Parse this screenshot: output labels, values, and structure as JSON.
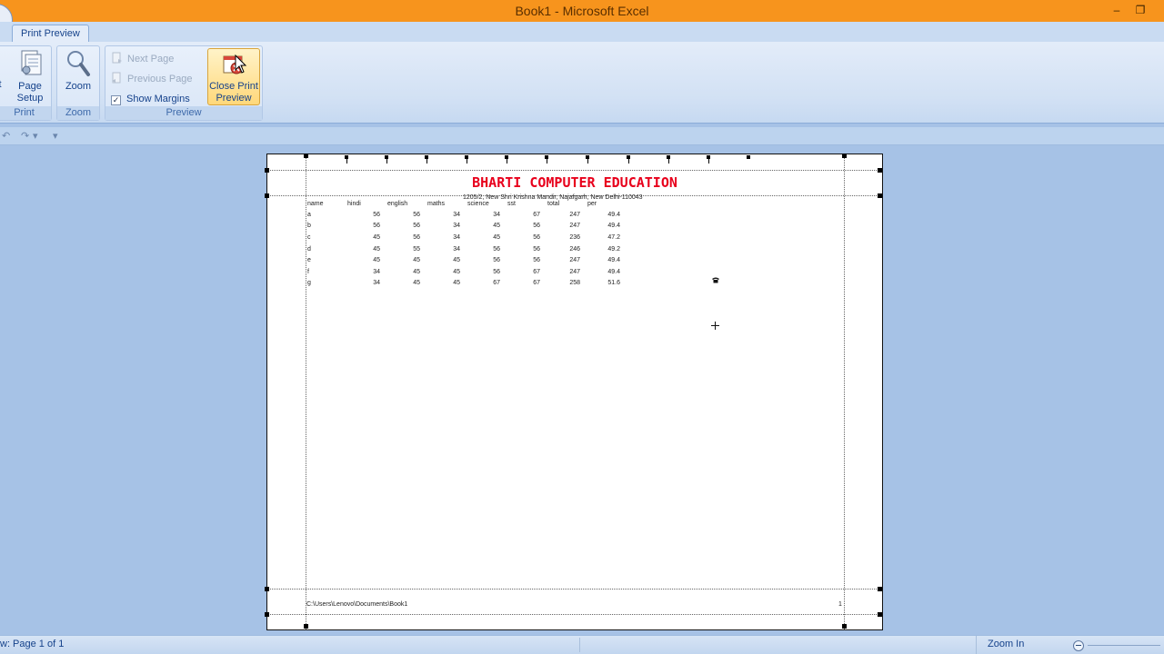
{
  "window": {
    "title": "Book1 - Microsoft Excel",
    "minimize": "–",
    "restore": "❐"
  },
  "ribbon": {
    "tab": "Print Preview",
    "groups": {
      "print": {
        "label": "Print",
        "page_setup": "Page\nSetup"
      },
      "zoom": {
        "label": "Zoom",
        "zoom_button": "Zoom"
      },
      "preview": {
        "label": "Preview",
        "next_page": "Next Page",
        "previous_page": "Previous Page",
        "show_margins": "Show Margins",
        "show_margins_checked": true,
        "close_print_preview": "Close Print\nPreview"
      }
    }
  },
  "page": {
    "title": "BHARTI COMPUTER EDUCATION",
    "subtitle": "1205/2, New Shri Krishna Mandir, Najafgarh, New Delhi-110043",
    "headers": [
      "name",
      "hindi",
      "english",
      "maths",
      "science",
      "sst",
      "total",
      "per"
    ],
    "rows": [
      [
        "a",
        "56",
        "56",
        "34",
        "34",
        "67",
        "247",
        "49.4"
      ],
      [
        "b",
        "56",
        "56",
        "34",
        "45",
        "56",
        "247",
        "49.4"
      ],
      [
        "c",
        "45",
        "56",
        "34",
        "45",
        "56",
        "236",
        "47.2"
      ],
      [
        "d",
        "45",
        "55",
        "34",
        "56",
        "56",
        "246",
        "49.2"
      ],
      [
        "e",
        "45",
        "45",
        "45",
        "56",
        "56",
        "247",
        "49.4"
      ],
      [
        "f",
        "34",
        "45",
        "45",
        "56",
        "67",
        "247",
        "49.4"
      ],
      [
        "g",
        "34",
        "45",
        "45",
        "67",
        "67",
        "258",
        "51.6"
      ]
    ],
    "footer_path": "C:\\Users\\Lenovo\\Documents\\Book1",
    "footer_page": "1"
  },
  "statusbar": {
    "left": "w: Page 1 of 1",
    "zoom_in": "Zoom In"
  },
  "colors": {
    "titlebar": "#f7941d",
    "title_text": "#e8001c",
    "workspace": "#a6c2e6"
  }
}
